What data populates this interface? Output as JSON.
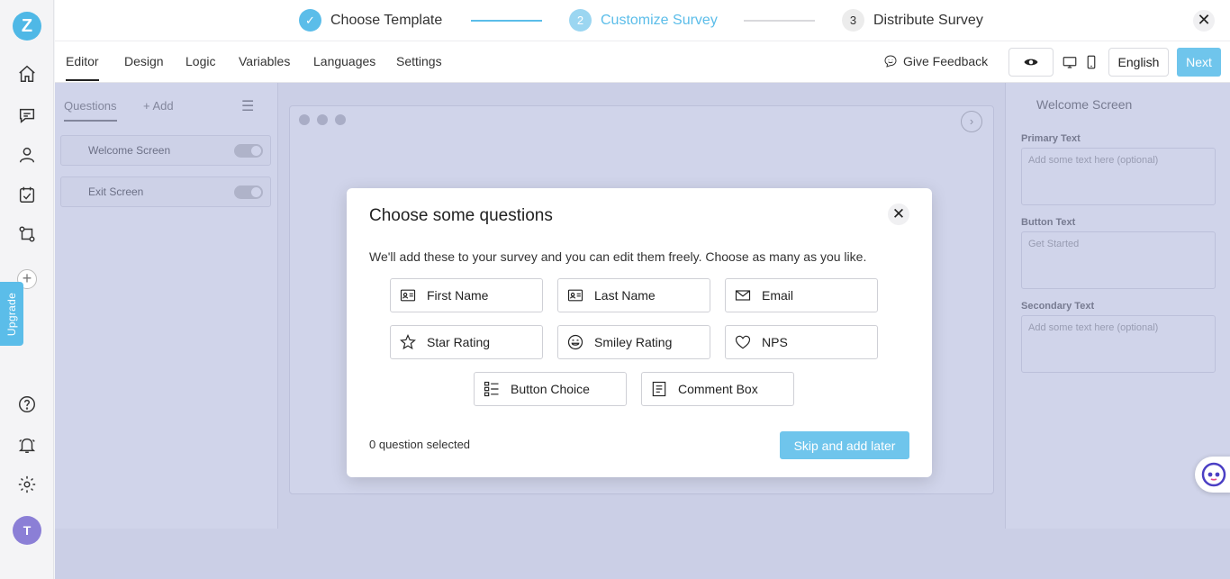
{
  "rail": {
    "logo": "Z",
    "upgrade": "Upgrade",
    "avatar": "T"
  },
  "stepper": {
    "steps": [
      {
        "num": "✓",
        "label": "Choose Template",
        "state": "done"
      },
      {
        "num": "2",
        "label": "Customize Survey",
        "state": "active"
      },
      {
        "num": "3",
        "label": "Distribute Survey",
        "state": "todo"
      }
    ],
    "close": "✕"
  },
  "tabs": [
    "Editor",
    "Design",
    "Logic",
    "Variables",
    "Languages",
    "Settings"
  ],
  "toolbar": {
    "feedback": "Give Feedback",
    "language": "English",
    "next": "Next"
  },
  "questions_panel": {
    "tab_questions": "Questions",
    "tab_add": "+ Add",
    "rows": [
      "Welcome Screen",
      "Exit Screen"
    ]
  },
  "right_panel": {
    "title": "Welcome Screen",
    "fields": [
      {
        "label": "Primary Text",
        "placeholder": "Add some text here (optional)"
      },
      {
        "label": "Button Text",
        "placeholder": "Get Started"
      },
      {
        "label": "Secondary Text",
        "placeholder": "Add some text here (optional)"
      }
    ]
  },
  "modal": {
    "title": "Choose some questions",
    "close": "✕",
    "description": "We'll add these to your survey and you can edit them freely. Choose as many as you like.",
    "options": [
      {
        "label": "First Name",
        "icon": "id-card-icon"
      },
      {
        "label": "Last Name",
        "icon": "id-card-icon"
      },
      {
        "label": "Email",
        "icon": "envelope-icon"
      },
      {
        "label": "Star Rating",
        "icon": "star-icon"
      },
      {
        "label": "Smiley Rating",
        "icon": "smiley-icon"
      },
      {
        "label": "NPS",
        "icon": "heart-icon"
      },
      {
        "label": "Button Choice",
        "icon": "list-icon"
      },
      {
        "label": "Comment Box",
        "icon": "comment-box-icon"
      }
    ],
    "selected_count": "0 question selected",
    "skip": "Skip and add later"
  },
  "colors": {
    "accent": "#5bbde9",
    "overlay": "#7884c4"
  }
}
